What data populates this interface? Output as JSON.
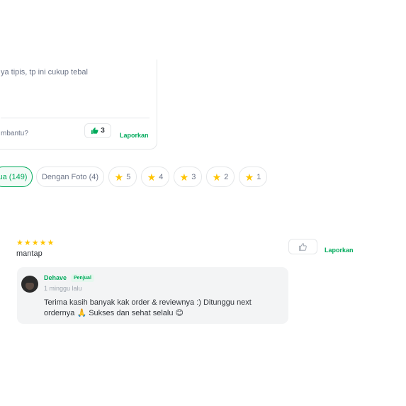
{
  "top_review": {
    "snippet": "ya tipis, tp ini cukup tebal",
    "helpful_question": "mbantu?",
    "like_count": "3",
    "report_label": "Laporkan"
  },
  "filters": [
    {
      "label": "ua (149)",
      "active": true
    },
    {
      "label": "Dengan Foto (4)",
      "active": false
    },
    {
      "label": "5",
      "star": true
    },
    {
      "label": "4",
      "star": true
    },
    {
      "label": "3",
      "star": true
    },
    {
      "label": "2",
      "star": true
    },
    {
      "label": "1",
      "star": true
    }
  ],
  "review": {
    "rating": 5,
    "text": "mantap",
    "report_label": "Laporkan"
  },
  "seller_reply": {
    "name": "Dehave",
    "badge": "Penjual",
    "time": "1 minggu lalu",
    "body": "Terima kasih banyak kak order & reviewnya :) Ditunggu next ordernya 🙏 Sukses dan sehat selalu 😊"
  },
  "colors": {
    "accent": "#00aa5b",
    "star": "#ffc400",
    "muted": "#6d7588"
  }
}
